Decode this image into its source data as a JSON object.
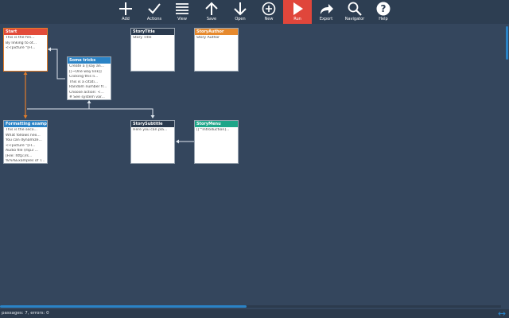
{
  "toolbar": {
    "buttons": [
      {
        "label": "Add",
        "icon": "plus-icon"
      },
      {
        "label": "Actions",
        "icon": "check-icon"
      },
      {
        "label": "View",
        "icon": "menu-icon"
      },
      {
        "label": "Save",
        "icon": "arrow-up-icon"
      },
      {
        "label": "Open",
        "icon": "arrow-down-icon"
      },
      {
        "label": "New",
        "icon": "plus-circle-icon"
      },
      {
        "label": "Run",
        "icon": "play-icon",
        "active": true
      },
      {
        "label": "Export",
        "icon": "share-icon"
      },
      {
        "label": "Navigator",
        "icon": "search-icon"
      },
      {
        "label": "Help",
        "icon": "help-icon"
      }
    ]
  },
  "colors": {
    "canvas": "#34465d",
    "toolbar": "#2d3e52",
    "run_active": "#e0463b",
    "header_start": "#e24b3a",
    "header_default": "#2a3a4e",
    "header_blue": "#2a83c6",
    "header_orange": "#e6892d",
    "header_green": "#1ea689",
    "link_orange": "#e37d2a",
    "link_white": "#dfe7ef"
  },
  "passages": [
    {
      "title": "Start",
      "lines": [
        "This is the firs...",
        "By linking to ot...",
        "<<picture \"[FI..."
      ]
    },
    {
      "title": "Some tricks",
      "lines": [
        "Create a [[say an...",
        "[[~One way link]]",
        "Clicking this li...",
        "This is a citati...",
        "Random number fr...",
        "Choose action: <...",
        "# See system var..."
      ]
    },
    {
      "title": "StoryTitle",
      "lines": [
        "Story Title"
      ]
    },
    {
      "title": "StoryAuthor",
      "lines": [
        "Story Author"
      ]
    },
    {
      "title": "Formatting examp...",
      "lines": [
        "This is the seco...",
        "What follows nex...",
        "You can dynamize...",
        "<<picture \"[FI...",
        "Audio file (mp3 ...",
        "[File: http://s...",
        "%%%Examples of T..."
      ]
    },
    {
      "title": "StorySubtitle",
      "lines": [
        "Here you can pla..."
      ]
    },
    {
      "title": "StoryMenu",
      "lines": [
        "[[^Introduction]..."
      ]
    }
  ],
  "status": {
    "text": "passages: 7, errors: 0"
  }
}
